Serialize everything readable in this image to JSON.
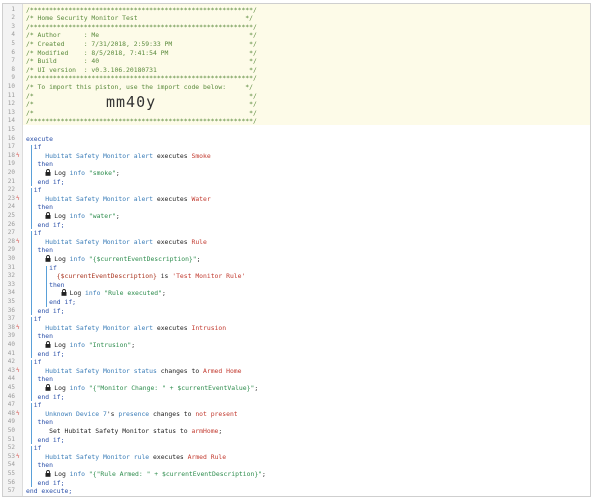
{
  "lines": [
    {
      "n": "1",
      "m": "",
      "c": "/**********************************************************/",
      "t": "cm"
    },
    {
      "n": "2",
      "m": "",
      "c": "/* Home Security Monitor Test                            */",
      "t": "cm"
    },
    {
      "n": "3",
      "m": "",
      "c": "/**********************************************************/",
      "t": "cm"
    },
    {
      "n": "4",
      "m": "",
      "c": "/* Author      : Me                                       */",
      "t": "cm"
    },
    {
      "n": "5",
      "m": "",
      "c": "/* Created     : 7/31/2018, 2:59:33 PM                    */",
      "t": "cm"
    },
    {
      "n": "6",
      "m": "",
      "c": "/* Modified    : 8/5/2018, 7:41:54 PM                     */",
      "t": "cm"
    },
    {
      "n": "7",
      "m": "",
      "c": "/* Build       : 40                                       */",
      "t": "cm"
    },
    {
      "n": "8",
      "m": "",
      "c": "/* UI version  : v0.3.106.20180731                        */",
      "t": "cm"
    },
    {
      "n": "9",
      "m": "",
      "c": "/**********************************************************/",
      "t": "cm"
    },
    {
      "n": "10",
      "m": "",
      "c": "/* To import this piston, use the import code below:     */",
      "t": "cm"
    },
    {
      "n": "11",
      "m": "",
      "c": "/*                                                        */",
      "t": "cm"
    },
    {
      "n": "12",
      "m": "",
      "c": "/*                                                        */",
      "t": "cm",
      "big": "mm40y"
    },
    {
      "n": "13",
      "m": "",
      "c": "/*                                                        */",
      "t": "cm"
    },
    {
      "n": "14",
      "m": "",
      "c": "/**********************************************************/",
      "t": "cm"
    },
    {
      "n": "15",
      "m": "",
      "c": "",
      "t": "tx"
    },
    {
      "n": "16",
      "m": "",
      "c": "execute",
      "t": "kw",
      "i": 0
    },
    {
      "n": "17",
      "m": "",
      "c": "if",
      "t": "kw",
      "i": 2
    },
    {
      "n": "18",
      "m": "ǫ",
      "parts": [
        [
          "Hubitat Safety Monitor",
          "dv"
        ],
        [
          " alert",
          "at"
        ],
        [
          " executes ",
          "tx"
        ],
        [
          "Smoke",
          "vl"
        ]
      ],
      "i": 5
    },
    {
      "n": "19",
      "m": "",
      "c": "then",
      "t": "kw",
      "i": 3
    },
    {
      "n": "20",
      "m": "",
      "lock": true,
      "parts": [
        [
          "Log ",
          "tx"
        ],
        [
          "info",
          "at"
        ],
        [
          " \"smoke\"",
          "st"
        ],
        [
          ";",
          "tx"
        ]
      ],
      "i": 5
    },
    {
      "n": "21",
      "m": "",
      "c": "end if;",
      "t": "kw",
      "i": 3
    },
    {
      "n": "22",
      "m": "",
      "c": "if",
      "t": "kw",
      "i": 2
    },
    {
      "n": "23",
      "m": "ǫ",
      "parts": [
        [
          "Hubitat Safety Monitor",
          "dv"
        ],
        [
          " alert",
          "at"
        ],
        [
          " executes ",
          "tx"
        ],
        [
          "Water",
          "vl"
        ]
      ],
      "i": 5
    },
    {
      "n": "24",
      "m": "",
      "c": "then",
      "t": "kw",
      "i": 3
    },
    {
      "n": "25",
      "m": "",
      "lock": true,
      "parts": [
        [
          "Log ",
          "tx"
        ],
        [
          "info",
          "at"
        ],
        [
          " \"water\"",
          "st"
        ],
        [
          ";",
          "tx"
        ]
      ],
      "i": 5
    },
    {
      "n": "26",
      "m": "",
      "c": "end if;",
      "t": "kw",
      "i": 3
    },
    {
      "n": "27",
      "m": "",
      "c": "if",
      "t": "kw",
      "i": 2
    },
    {
      "n": "28",
      "m": "ǫ",
      "parts": [
        [
          "Hubitat Safety Monitor",
          "dv"
        ],
        [
          " alert",
          "at"
        ],
        [
          " executes ",
          "tx"
        ],
        [
          "Rule",
          "vl"
        ]
      ],
      "i": 5
    },
    {
      "n": "29",
      "m": "",
      "c": "then",
      "t": "kw",
      "i": 3
    },
    {
      "n": "30",
      "m": "",
      "lock": true,
      "parts": [
        [
          "Log ",
          "tx"
        ],
        [
          "info",
          "at"
        ],
        [
          " \"{$currentEventDescription}\"",
          "st"
        ],
        [
          ";",
          "tx"
        ]
      ],
      "i": 5
    },
    {
      "n": "31",
      "m": "",
      "c": "if",
      "t": "kw",
      "i": 6
    },
    {
      "n": "32",
      "m": "",
      "parts": [
        [
          "{$currentEventDescription}",
          "vr"
        ],
        [
          " is ",
          "tx"
        ],
        [
          "'Test Monitor Rule'",
          "vl"
        ]
      ],
      "i": 8
    },
    {
      "n": "33",
      "m": "",
      "c": "then",
      "t": "kw",
      "i": 6
    },
    {
      "n": "34",
      "m": "",
      "lock": true,
      "parts": [
        [
          "Log ",
          "tx"
        ],
        [
          "info",
          "at"
        ],
        [
          " \"Rule executed\"",
          "st"
        ],
        [
          ";",
          "tx"
        ]
      ],
      "i": 9
    },
    {
      "n": "35",
      "m": "",
      "c": "end if;",
      "t": "kw",
      "i": 6
    },
    {
      "n": "36",
      "m": "",
      "c": "end if;",
      "t": "kw",
      "i": 3
    },
    {
      "n": "37",
      "m": "",
      "c": "if",
      "t": "kw",
      "i": 2
    },
    {
      "n": "38",
      "m": "ǫ",
      "parts": [
        [
          "Hubitat Safety Monitor",
          "dv"
        ],
        [
          " alert",
          "at"
        ],
        [
          " executes ",
          "tx"
        ],
        [
          "Intrusion",
          "vl"
        ]
      ],
      "i": 5
    },
    {
      "n": "39",
      "m": "",
      "c": "then",
      "t": "kw",
      "i": 3
    },
    {
      "n": "40",
      "m": "",
      "lock": true,
      "parts": [
        [
          "Log ",
          "tx"
        ],
        [
          "info",
          "at"
        ],
        [
          " \"Intrusion\"",
          "st"
        ],
        [
          ";",
          "tx"
        ]
      ],
      "i": 5
    },
    {
      "n": "41",
      "m": "",
      "c": "end if;",
      "t": "kw",
      "i": 3
    },
    {
      "n": "42",
      "m": "",
      "c": "if",
      "t": "kw",
      "i": 2
    },
    {
      "n": "43",
      "m": "ǫ",
      "parts": [
        [
          "Hubitat Safety Monitor",
          "dv"
        ],
        [
          " status",
          "at"
        ],
        [
          " changes to ",
          "tx"
        ],
        [
          "Armed Home",
          "vl"
        ]
      ],
      "i": 5
    },
    {
      "n": "44",
      "m": "",
      "c": "then",
      "t": "kw",
      "i": 3
    },
    {
      "n": "45",
      "m": "",
      "lock": true,
      "parts": [
        [
          "Log ",
          "tx"
        ],
        [
          "info",
          "at"
        ],
        [
          " \"{\"Monitor Change: \" + $currentEventValue}\"",
          "st"
        ],
        [
          ";",
          "tx"
        ]
      ],
      "i": 5
    },
    {
      "n": "46",
      "m": "",
      "c": "end if;",
      "t": "kw",
      "i": 3
    },
    {
      "n": "47",
      "m": "",
      "c": "if",
      "t": "kw",
      "i": 2
    },
    {
      "n": "48",
      "m": "ǫ",
      "parts": [
        [
          "Unknown Device 7",
          "dv"
        ],
        [
          "'s ",
          "tx"
        ],
        [
          "presence",
          "at"
        ],
        [
          " changes to ",
          "tx"
        ],
        [
          "not present",
          "vl"
        ]
      ],
      "i": 5
    },
    {
      "n": "49",
      "m": "",
      "c": "then",
      "t": "kw",
      "i": 3
    },
    {
      "n": "50",
      "m": "",
      "parts": [
        [
          "Set Hubitat Safety Monitor status to ",
          "tx"
        ],
        [
          "armHome",
          "vl"
        ],
        [
          ";",
          "tx"
        ]
      ],
      "i": 6
    },
    {
      "n": "51",
      "m": "",
      "c": "end if;",
      "t": "kw",
      "i": 3
    },
    {
      "n": "52",
      "m": "",
      "c": "if",
      "t": "kw",
      "i": 2
    },
    {
      "n": "53",
      "m": "ǫ",
      "parts": [
        [
          "Hubitat Safety Monitor",
          "dv"
        ],
        [
          " rule",
          "at"
        ],
        [
          " executes ",
          "tx"
        ],
        [
          "Armed Rule",
          "vl"
        ]
      ],
      "i": 5
    },
    {
      "n": "54",
      "m": "",
      "c": "then",
      "t": "kw",
      "i": 3
    },
    {
      "n": "55",
      "m": "",
      "lock": true,
      "parts": [
        [
          "Log ",
          "tx"
        ],
        [
          "info",
          "at"
        ],
        [
          " \"{\"Rule Armed: \" + $currentEventDescription}\"",
          "st"
        ],
        [
          ";",
          "tx"
        ]
      ],
      "i": 5
    },
    {
      "n": "56",
      "m": "",
      "c": "end if;",
      "t": "kw",
      "i": 3
    },
    {
      "n": "57",
      "m": "",
      "c": "end execute;",
      "t": "kw",
      "i": 0
    }
  ],
  "colors": {
    "comment": "#5a8a3c",
    "keyword": "#2a4fa8",
    "device": "#3b7db8",
    "value": "#c23a2f",
    "string": "#2c8c4c"
  }
}
